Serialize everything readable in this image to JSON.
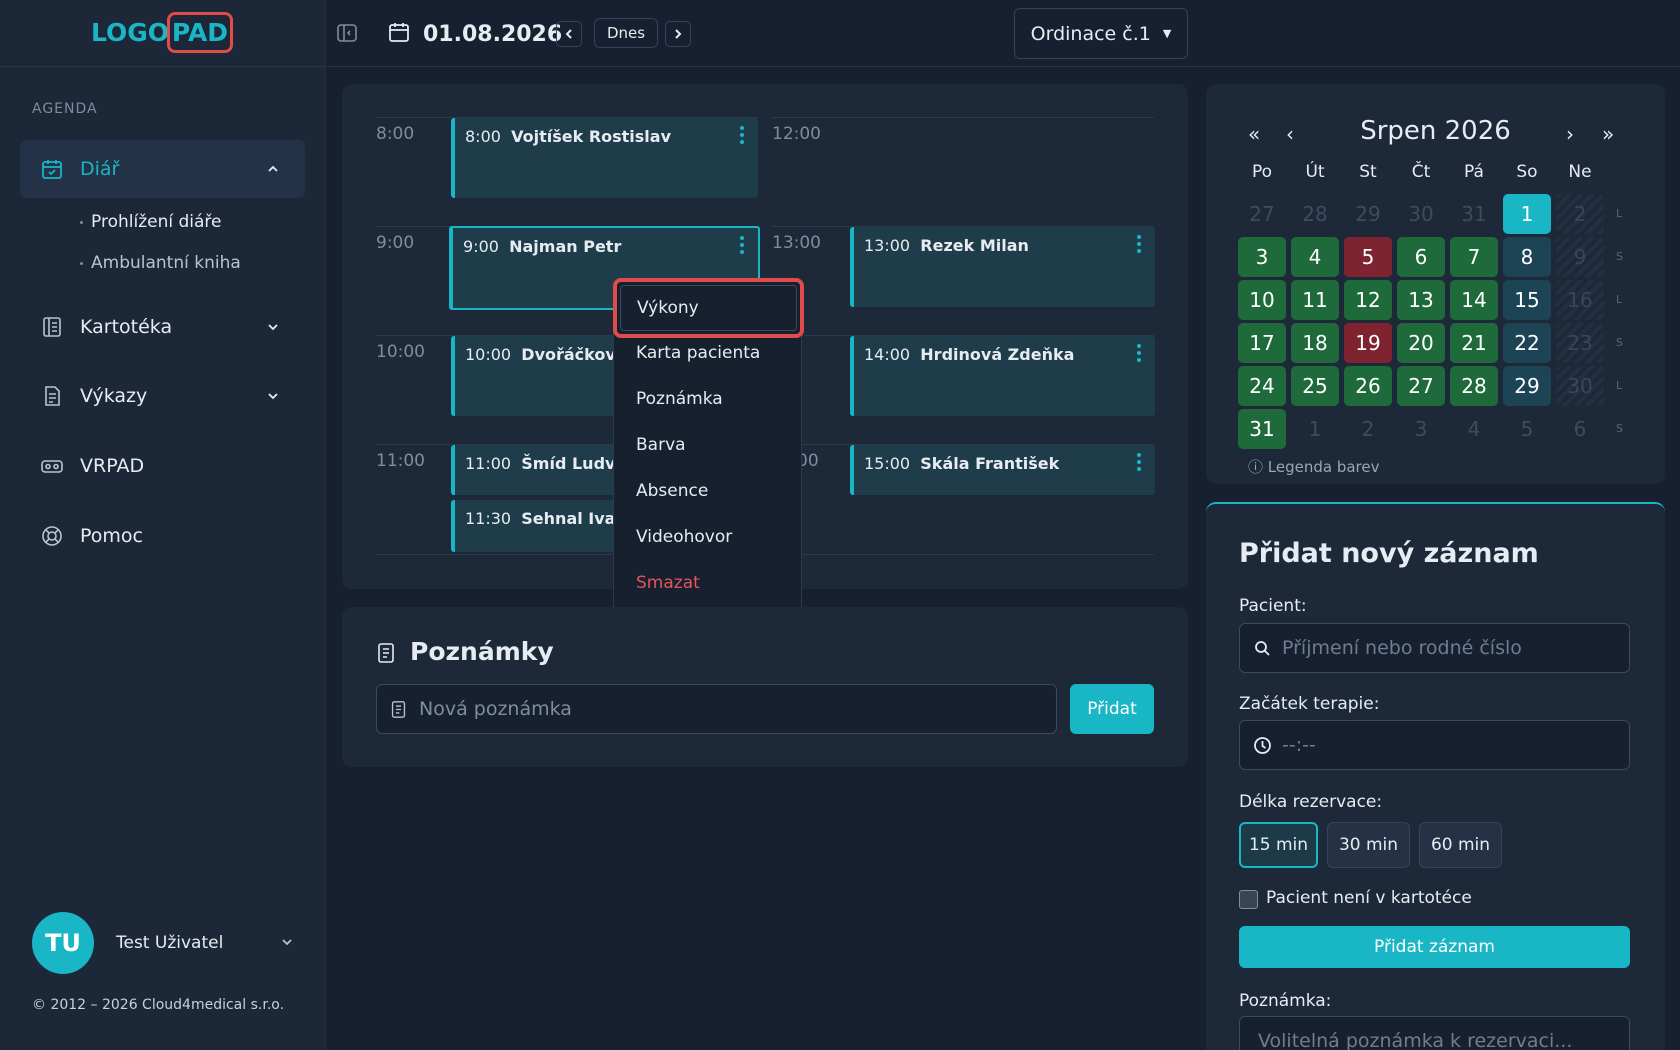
{
  "logo": {
    "part1": "LOGO",
    "part2": "PAD"
  },
  "sidebar": {
    "section": "AGENDA",
    "items": [
      {
        "label": "Diář",
        "icon": "calendar-check-icon"
      },
      {
        "label": "Kartotéka",
        "icon": "book-icon"
      },
      {
        "label": "Výkazy",
        "icon": "report-icon"
      },
      {
        "label": "VRPAD",
        "icon": "vr-headset-icon"
      },
      {
        "label": "Pomoc",
        "icon": "lifebuoy-icon"
      }
    ],
    "sub_items": [
      "Prohlížení diáře",
      "Ambulantní kniha"
    ]
  },
  "user": {
    "initials": "TU",
    "name": "Test Uživatel"
  },
  "copyright": "© 2012 – 2026 Cloud4medical s.r.o.",
  "topbar": {
    "date": "01.08.2026",
    "today": "Dnes",
    "room": "Ordinace č.1"
  },
  "schedule": {
    "hours_left": [
      "8:00",
      "9:00",
      "10:00",
      "11:00"
    ],
    "hours_right": [
      "12:00",
      "13:00",
      "14:00",
      "15:00"
    ],
    "events": [
      {
        "time": "8:00",
        "name": "Vojtíšek Rostislav"
      },
      {
        "time": "9:00",
        "name": "Najman Petr"
      },
      {
        "time": "10:00",
        "name": "Dvořáčková I"
      },
      {
        "time": "11:00",
        "name": "Šmíd Ludvík"
      },
      {
        "time": "11:30",
        "name": "Sehnal Ivan"
      },
      {
        "time": "13:00",
        "name": "Rezek Milan"
      },
      {
        "time": "14:00",
        "name": "Hrdinová Zdeňka"
      },
      {
        "time": "15:00",
        "name": "Skála František"
      }
    ],
    "partial_hours": [
      "00",
      "00"
    ]
  },
  "context_menu": [
    "Výkony",
    "Karta pacienta",
    "Poznámka",
    "Barva",
    "Absence",
    "Videohovor",
    "Smazat"
  ],
  "notes": {
    "title": "Poznámky",
    "placeholder": "Nová poznámka",
    "add": "Přidat"
  },
  "calendar": {
    "month": "Srpen 2026",
    "days": [
      "Po",
      "Út",
      "St",
      "Čt",
      "Pá",
      "So",
      "Ne"
    ],
    "weeks": [
      [
        [
          "27",
          "mute"
        ],
        [
          "28",
          "mute"
        ],
        [
          "29",
          "mute"
        ],
        [
          "30",
          "mute"
        ],
        [
          "31",
          "mute"
        ],
        [
          "1",
          "cy"
        ],
        [
          "2",
          "hatch"
        ]
      ],
      [
        [
          "3",
          "g"
        ],
        [
          "4",
          "g"
        ],
        [
          "5",
          "r"
        ],
        [
          "6",
          "g"
        ],
        [
          "7",
          "g"
        ],
        [
          "8",
          "t"
        ],
        [
          "9",
          "hatch"
        ]
      ],
      [
        [
          "10",
          "g"
        ],
        [
          "11",
          "g"
        ],
        [
          "12",
          "g"
        ],
        [
          "13",
          "g"
        ],
        [
          "14",
          "g"
        ],
        [
          "15",
          "t"
        ],
        [
          "16",
          "hatch"
        ]
      ],
      [
        [
          "17",
          "g"
        ],
        [
          "18",
          "g"
        ],
        [
          "19",
          "r"
        ],
        [
          "20",
          "g"
        ],
        [
          "21",
          "g"
        ],
        [
          "22",
          "t"
        ],
        [
          "23",
          "hatch"
        ]
      ],
      [
        [
          "24",
          "g"
        ],
        [
          "25",
          "g"
        ],
        [
          "26",
          "g"
        ],
        [
          "27",
          "g"
        ],
        [
          "28",
          "g"
        ],
        [
          "29",
          "t"
        ],
        [
          "30",
          "hatch"
        ]
      ],
      [
        [
          "31",
          "g"
        ],
        [
          "1",
          "mute"
        ],
        [
          "2",
          "mute"
        ],
        [
          "3",
          "mute"
        ],
        [
          "4",
          "mute"
        ],
        [
          "5",
          "mute"
        ],
        [
          "6",
          "mute"
        ]
      ]
    ],
    "week_marks": [
      "L",
      "S",
      "L",
      "S",
      "L",
      "S"
    ],
    "legend": "Legenda barev"
  },
  "form": {
    "title": "Přidat nový záznam",
    "patient_label": "Pacient:",
    "patient_placeholder": "Příjmení nebo rodné číslo",
    "start_label": "Začátek terapie:",
    "start_placeholder": "--:--",
    "duration_label": "Délka rezervace:",
    "durations": [
      "15 min",
      "30 min",
      "60 min"
    ],
    "not_in_registry": "Pacient není v kartotéce",
    "submit": "Přidat záznam",
    "note_label": "Poznámka:",
    "note_placeholder": "Volitelná poznámka k rezervaci..."
  },
  "colors": {
    "accent": "#19b6c6",
    "green": "#1f6a3a",
    "red": "#7d2430",
    "highlight": "#e04b4b"
  }
}
